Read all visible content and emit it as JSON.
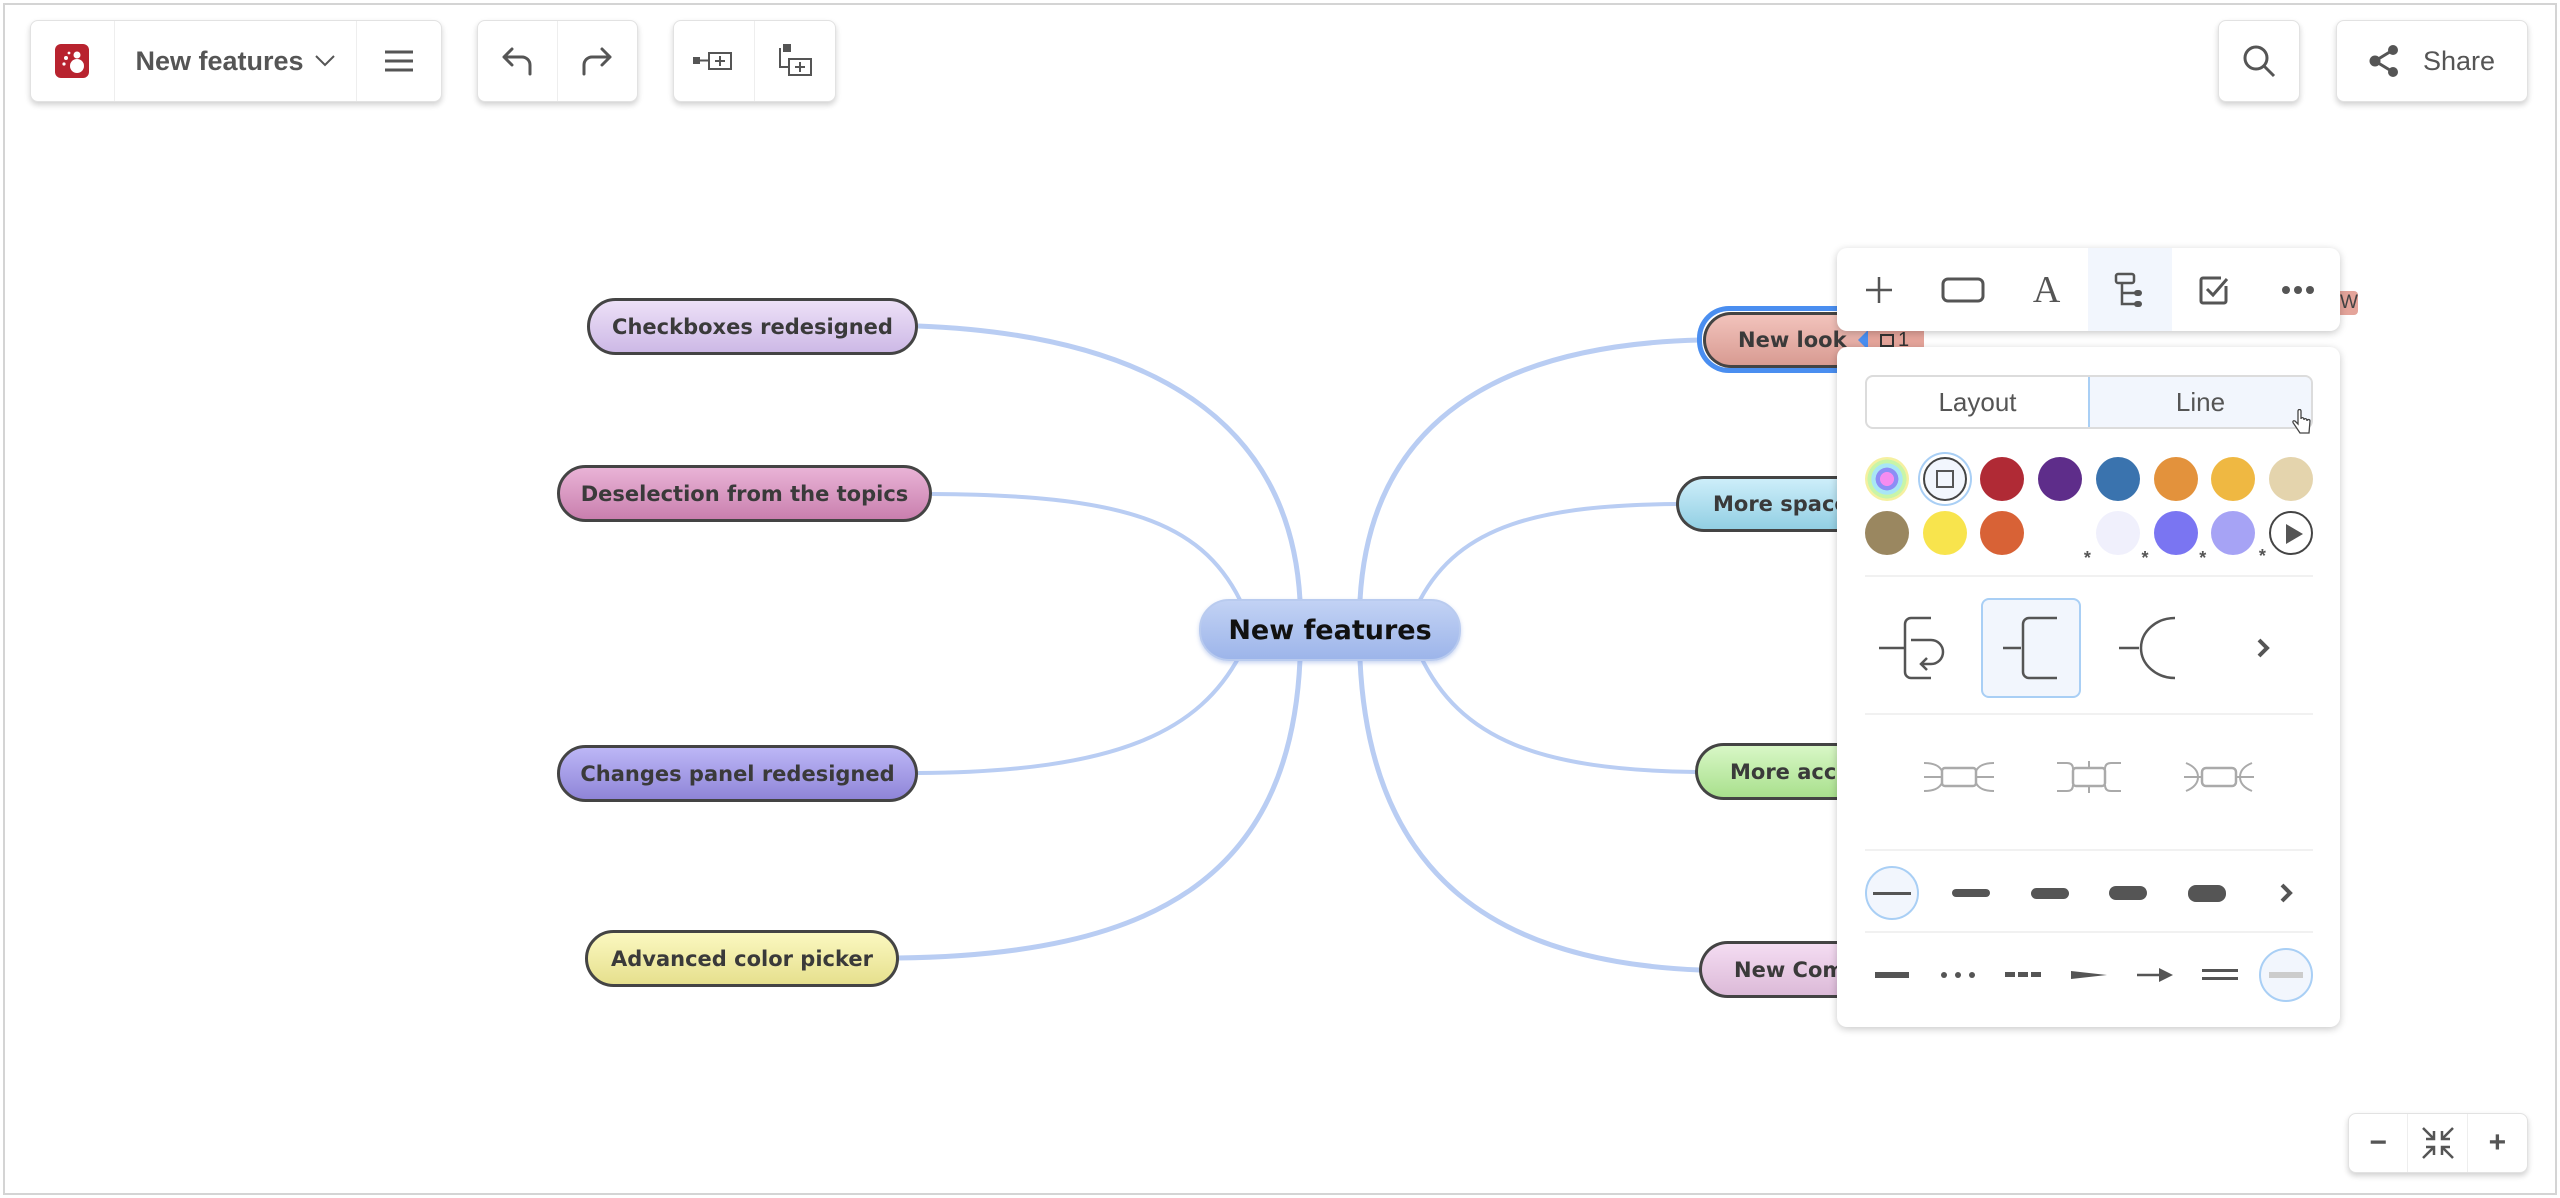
{
  "toolbar": {
    "app_logo": "app-logo",
    "title": "New features",
    "title_dropdown_icon": "chevron-down-icon",
    "menu_icon": "hamburger-icon",
    "undo_icon": "undo-icon",
    "redo_icon": "redo-icon",
    "add_sibling_icon": "add-sibling-topic-icon",
    "add_child_icon": "add-child-topic-icon",
    "search_icon": "search-icon",
    "share_label": "Share",
    "share_icon": "share-icon"
  },
  "mindmap": {
    "central": {
      "label": "New features",
      "color": "#a9bfee"
    },
    "left_topics": [
      {
        "label": "Checkboxes redesigned",
        "color_top": "#ede0f7",
        "color_bottom": "#cdb9e6"
      },
      {
        "label": "Deselection from the topics",
        "color_top": "#e9b3d6",
        "color_bottom": "#c97fae"
      },
      {
        "label": "Changes panel redesigned",
        "color_top": "#bcb6f6",
        "color_bottom": "#8f85d8"
      },
      {
        "label": "Advanced color picker",
        "color_top": "#fbf8c0",
        "color_bottom": "#e6e08e"
      }
    ],
    "right_topics": [
      {
        "label": "New look",
        "color_top": "#f2c3bc",
        "color_bottom": "#d89b92",
        "selected": true,
        "badge": "1"
      },
      {
        "label": "More space",
        "color_top": "#cdeefa",
        "color_bottom": "#92cfe3"
      },
      {
        "label": "More acce",
        "color_top": "#d8f7c6",
        "color_bottom": "#a9e08d"
      },
      {
        "label": "New Com",
        "color_top": "#f4dcf2",
        "color_bottom": "#dcbad8"
      }
    ],
    "hidden_label_fragment": "W",
    "link_color": "#b9cdf3"
  },
  "topic_toolbar": {
    "tools": [
      {
        "name": "add-topic-icon",
        "active": false
      },
      {
        "name": "shape-icon",
        "active": false
      },
      {
        "name": "text-style-icon",
        "active": false
      },
      {
        "name": "layout-branch-icon",
        "active": true
      },
      {
        "name": "checkbox-icon",
        "active": false
      },
      {
        "name": "more-icon",
        "active": false
      }
    ]
  },
  "panel": {
    "tabs": [
      {
        "label": "Layout",
        "active": false
      },
      {
        "label": "Line",
        "active": true
      }
    ],
    "colors_row1": [
      {
        "name": "rainbow-auto",
        "color": "rainbow"
      },
      {
        "name": "no-color",
        "color": "none",
        "selected": true
      },
      {
        "name": "red",
        "color": "#b02a35"
      },
      {
        "name": "purple",
        "color": "#5e2d8a"
      },
      {
        "name": "blue",
        "color": "#3a73ae"
      },
      {
        "name": "orange",
        "color": "#e3923c"
      },
      {
        "name": "yellow-orange",
        "color": "#efb842"
      },
      {
        "name": "beige",
        "color": "#e4d4ad"
      }
    ],
    "colors_row2": [
      {
        "name": "olive",
        "color": "#9a8760"
      },
      {
        "name": "yellow",
        "color": "#f8e44d"
      },
      {
        "name": "red-orange",
        "color": "#d86236"
      },
      {
        "name": "empty",
        "color": "none"
      },
      {
        "name": "custom-1",
        "color": "#f0f0fc",
        "custom": true
      },
      {
        "name": "custom-2",
        "color": "#7a75f2",
        "custom": true
      },
      {
        "name": "custom-3",
        "color": "#a6a3f5",
        "custom": true
      },
      {
        "name": "more-colors",
        "color": "play",
        "custom": true
      }
    ],
    "line_styles": [
      "branch-return-icon",
      "branch-square-icon",
      "branch-curve-icon"
    ],
    "line_styles_selected": 1,
    "connector_styles": [
      "connector-curved-icon",
      "connector-straight-icon",
      "connector-rounded-icon"
    ],
    "thickness": [
      "thin",
      "medium",
      "thick",
      "thicker",
      "thickest"
    ],
    "thickness_selected": 0,
    "patterns": [
      "solid",
      "dotted",
      "dashed",
      "tapered",
      "arrow",
      "double",
      "none"
    ],
    "patterns_selected": 6
  },
  "zoom_controls": {
    "zoom_out": "−",
    "fit": "fit-to-screen-icon",
    "zoom_in": "+"
  }
}
